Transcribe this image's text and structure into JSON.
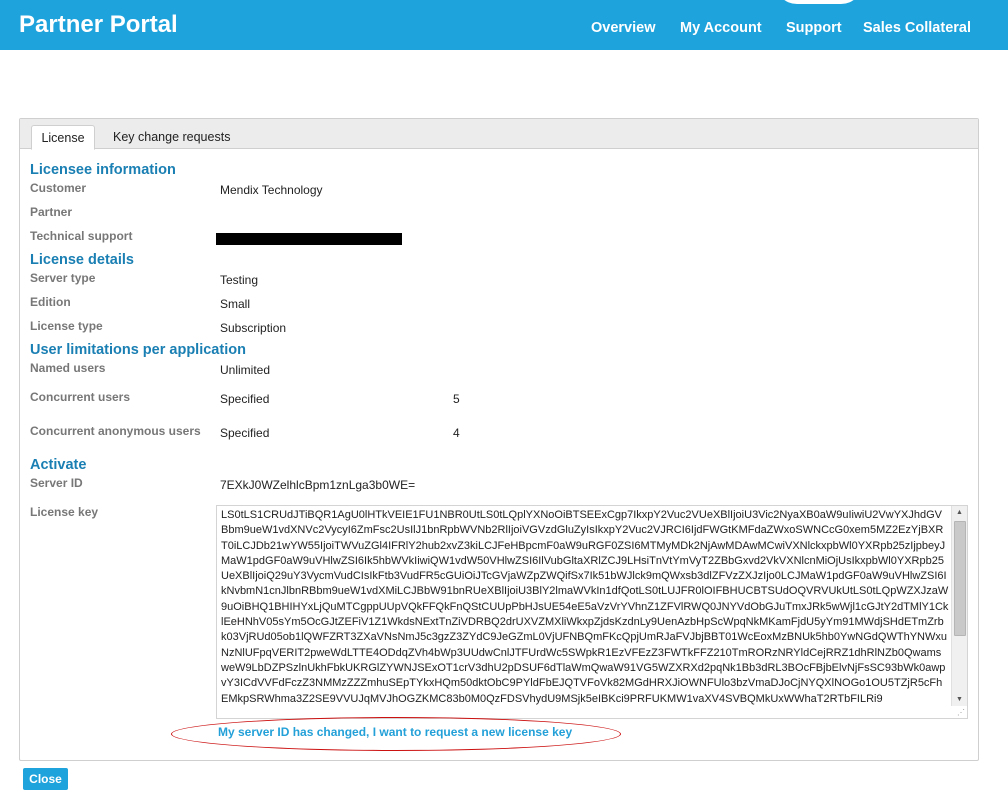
{
  "header": {
    "brand": "Partner Portal",
    "nav": [
      "Overview",
      "My Account",
      "Support",
      "Sales Collateral"
    ]
  },
  "tabs": [
    "License",
    "Key change requests"
  ],
  "licensee": {
    "title": "Licensee information",
    "customer_label": "Customer",
    "customer_value": "Mendix Technology",
    "partner_label": "Partner",
    "technical_support_label": "Technical support"
  },
  "details": {
    "title": "License details",
    "server_type_label": "Server type",
    "server_type_value": "Testing",
    "edition_label": "Edition",
    "edition_value": "Small",
    "license_type_label": "License type",
    "license_type_value": "Subscription"
  },
  "limits": {
    "title": "User limitations per application",
    "named_label": "Named users",
    "named_value": "Unlimited",
    "concurrent_label": "Concurrent users",
    "concurrent_value": "Specified",
    "concurrent_count": "5",
    "anon_label": "Concurrent anonymous users",
    "anon_value": "Specified",
    "anon_count": "4"
  },
  "activate": {
    "title": "Activate",
    "server_id_label": "Server ID",
    "server_id_value": "7EXkJ0WZelhlcBpm1znLga3b0WE=",
    "license_key_label": "License key",
    "license_key_value": "LS0tLS1CRUdJTiBQR1AgU0lHTkVEIE1FU1NBR0UtLS0tLQplYXNoOiBTSEExCgp7IkxpY2Vuc2VUeXBlIjoiU3Vic2NyaXB0aW9uIiwiU2VwYXJhdGVBbm9ueW1vdXNVc2VycyI6ZmFsc2UsIlJ1bnRpbWVNb2RlIjoiVGVzdGluZyIsIkxpY2Vuc2VJRCI6IjdFWGtKMFdaZWxoSWNCcG0xem5MZ2EzYjBXRT0iLCJDb21wYW55IjoiTWVuZGl4IFRlY2hub2xvZ3kiLCJFeHBpcmF0aW9uRGF0ZSI6MTMyMDk2NjAwMDAwMCwiVXNlckxpbWl0YXRpb25zIjpbeyJMaW1pdGF0aW9uVHlwZSI6Ik5hbWVkIiwiQW1vdW50VHlwZSI6IlVubGltaXRlZCJ9LHsiTnVtYmVyT2ZBbGxvd2VkVXNlcnMiOjUsIkxpbWl0YXRpb25UeXBlIjoiQ29uY3VycmVudCIsIkFtb3VudFR5cGUiOiJTcGVjaWZpZWQifSx7Ik51bWJlck9mQWxsb3dlZFVzZXJzIjo0LCJMaW1pdGF0aW9uVHlwZSI6IkNvbmN1cnJlbnRBbm9ueW1vdXMiLCJBbW91bnRUeXBlIjoiU3BlY2lmaWVkIn1dfQotLS0tLUJFR0lOIFBHUCBTSUdOQVRVUkUtLS0tLQpWZXJzaW9uOiBHQ1BHIHYxLjQuMTCgppUUpVQkFFQkFnQStCUUpPbHJsUE54eE5aVzVrYVhnZ1ZFVlRWQ0JNYVdObGJuTmxJRk5wWjl1cGJtY2dTMlY1CklEeHNhV05sYm5OcGJtZEFiV1Z1WkdsNExtTnZiVDRBQ2drUXVZMXliWkxpZjdsKzdnLy9UenAzbHpScWpqNkMKamFjdU5yYm91MWdjSHdETmZrbk03VjRUd05ob1lQWFZRT3ZXaVNsNmJ5c3gzZ3ZYdC9JeGZmL0VjUFNBQmFKcQpjUmRJaFVJbjBBT01WcEoxMzBNUk5hb0YwNGdQWThYNWxuNzNlUFpqVERIT2pweWdLTTE4ODdqZVh4bWp3UUdwCnlJTFUrdWc5SWpkR1EzVFEzZ3FWTkFFZ210TmRORzNRYldCejRRZ1dhRlNZb0QwamsweW9LbDZPSzlnUkhFbkUKRGlZYWNJSExOT1crV3dhU2pDSUF6dTlaWmQwaW91VG5WZXRXd2pqNk1Bb3dRL3BOcFBjbElvNjFsSC93bWk0awpvY3ICdVVFdFczZ3NMMzZZZmhuSEpTYkxHQm50dktObC9PYldFbEJQTVFoVk82MGdHRXJiOWNFUlo3bzVmaDJoCjNYQXlNOGo1OU5TZjR5cFhEMkpSRWhma3Z2SE9VVUJqMVJhOGZKMC83b0M0QzFDSVhydU9MSjk5eIBKci9PRFUKMW1vaXV4SVBQMkUxWWhaT2RTbFILRi9"
  },
  "link_text": "My server ID has changed, I want to request a new license key",
  "close_label": "Close"
}
